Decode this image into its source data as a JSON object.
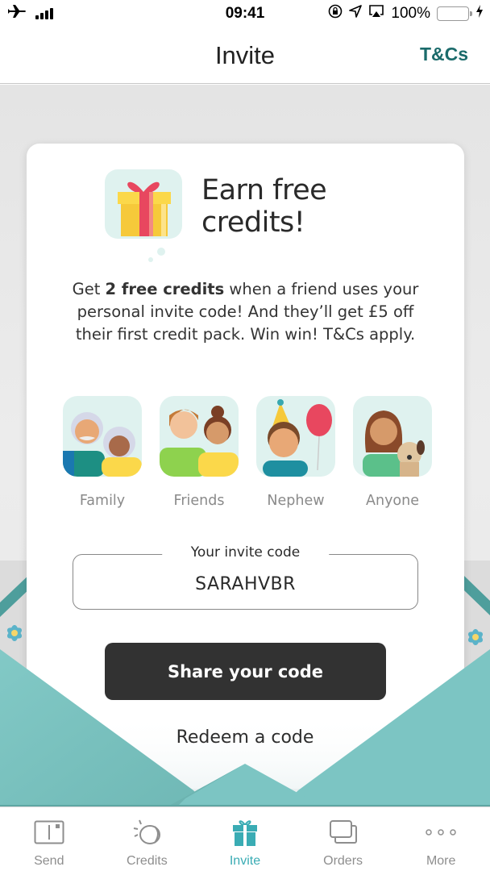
{
  "status_bar": {
    "time": "09:41",
    "battery_percent": "100%",
    "battery_level": 1.0,
    "icons": [
      "airplane-mode-icon",
      "signal-icon",
      "rotation-lock-icon",
      "location-icon",
      "airplay-icon",
      "battery-icon",
      "charging-icon"
    ]
  },
  "nav": {
    "title": "Invite",
    "action_label": "T&Cs"
  },
  "hero": {
    "title_line1": "Earn free",
    "title_line2": "credits!",
    "icon": "gift-icon"
  },
  "description": {
    "prefix": "Get ",
    "bold": "2 free credits",
    "suffix": " when a friend uses your personal invite code! And they’ll get £5 off their first credit pack. Win win! T&Cs apply."
  },
  "people": [
    {
      "label": "Family"
    },
    {
      "label": "Friends"
    },
    {
      "label": "Nephew"
    },
    {
      "label": "Anyone"
    }
  ],
  "invite_code": {
    "label": "Your invite code",
    "value": "SARAHVBR"
  },
  "actions": {
    "share_label": "Share your code",
    "redeem_label": "Redeem a code"
  },
  "tab_bar": {
    "active_index": 2,
    "accent_color": "#3aacb4",
    "items": [
      {
        "label": "Send",
        "icon": "send-card-icon"
      },
      {
        "label": "Credits",
        "icon": "coin-icon"
      },
      {
        "label": "Invite",
        "icon": "gift-icon"
      },
      {
        "label": "Orders",
        "icon": "orders-icon"
      },
      {
        "label": "More",
        "icon": "more-dots-icon"
      }
    ]
  },
  "colors": {
    "brand_teal": "#1b6b6b",
    "envelope_teal": "#7cc5c3",
    "button_dark": "#323232"
  }
}
